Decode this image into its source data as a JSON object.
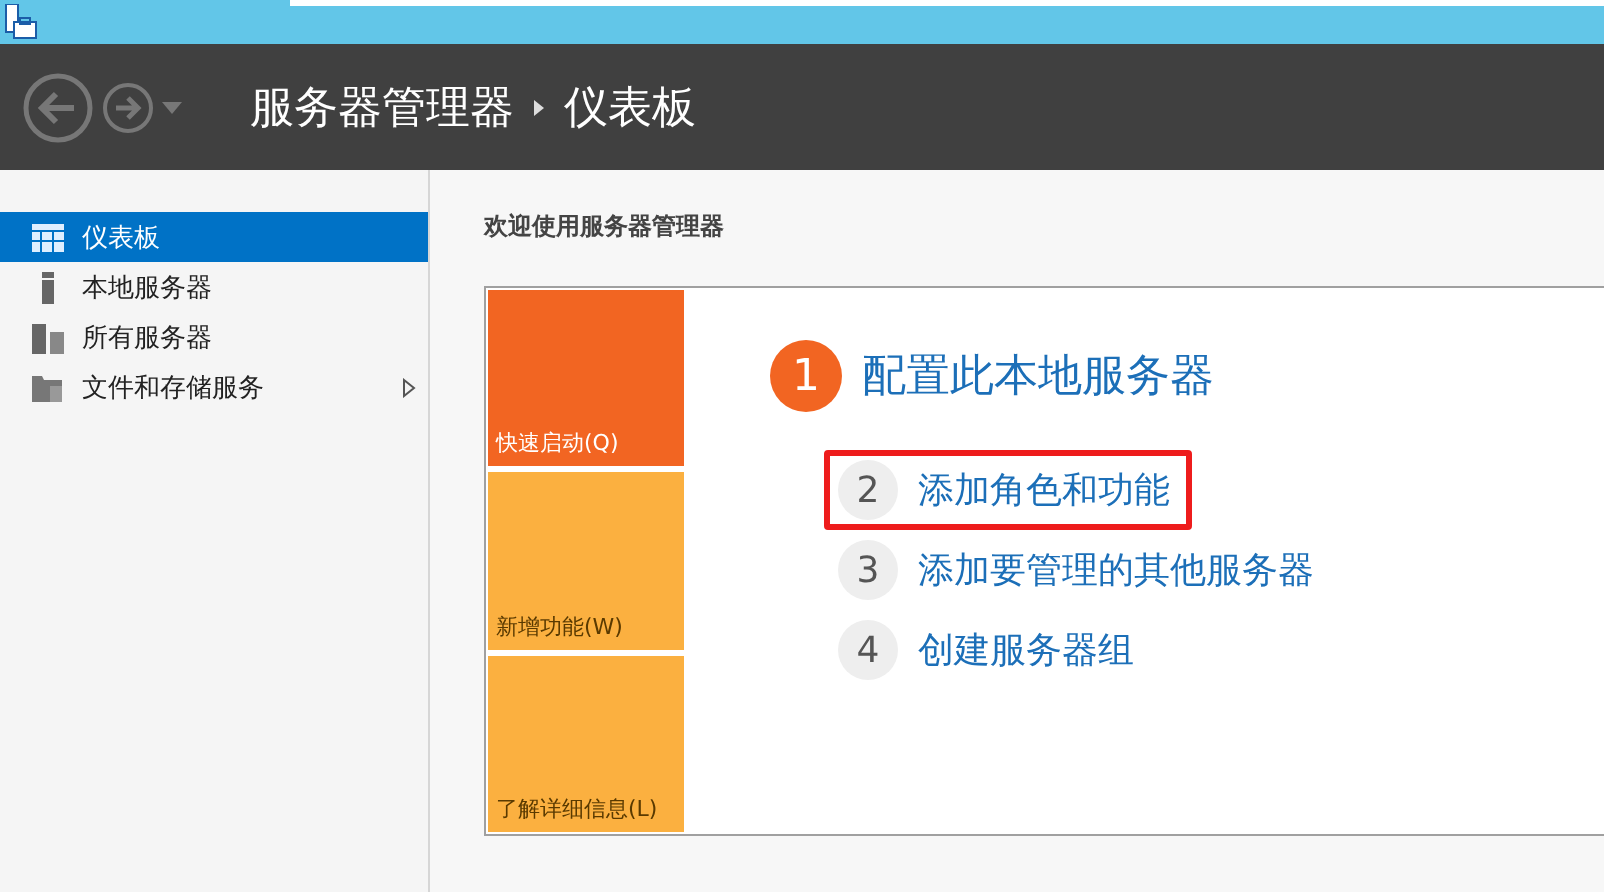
{
  "header": {
    "breadcrumb": [
      "服务器管理器",
      "仪表板"
    ]
  },
  "sidebar": {
    "items": [
      {
        "label": "仪表板",
        "kind": "dashboard",
        "selected": true,
        "expandable": false
      },
      {
        "label": "本地服务器",
        "kind": "server",
        "selected": false,
        "expandable": false
      },
      {
        "label": "所有服务器",
        "kind": "servers",
        "selected": false,
        "expandable": false
      },
      {
        "label": "文件和存储服务",
        "kind": "storage",
        "selected": false,
        "expandable": true
      }
    ]
  },
  "main": {
    "heading": "欢迎使用服务器管理器",
    "tiles": [
      {
        "label": "快速启动(Q)",
        "color": "#f26522"
      },
      {
        "label": "新增功能(W)",
        "color": "#fbb040"
      },
      {
        "label": "了解详细信息(L)",
        "color": "#fbb040"
      }
    ],
    "steps": [
      {
        "number": "1",
        "label": "配置此本地服务器",
        "kind": "primary",
        "highlighted": false
      },
      {
        "number": "2",
        "label": "添加角色和功能",
        "kind": "secondary",
        "highlighted": true
      },
      {
        "number": "3",
        "label": "添加要管理的其他服务器",
        "kind": "secondary",
        "highlighted": false
      },
      {
        "number": "4",
        "label": "创建服务器组",
        "kind": "secondary",
        "highlighted": false
      }
    ]
  }
}
